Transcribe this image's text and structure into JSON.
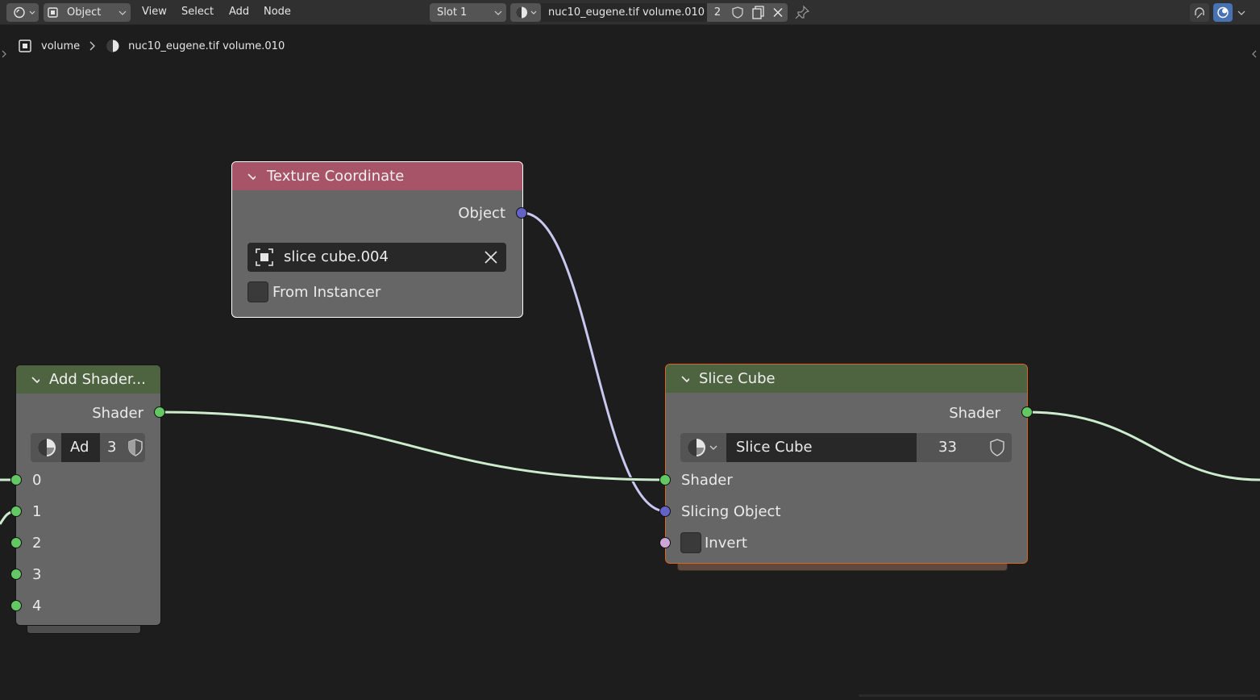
{
  "header": {
    "mode": "Object",
    "menus": [
      "View",
      "Select",
      "Add",
      "Node"
    ],
    "slot": "Slot 1",
    "material_name": "nuc10_eugene.tif volume.010",
    "user_count": "2"
  },
  "breadcrumb": {
    "object": "volume",
    "material": "nuc10_eugene.tif volume.010"
  },
  "nodes": {
    "texture_coordinate": {
      "title": "Texture Coordinate",
      "output": "Object",
      "object_field": "slice cube.004",
      "from_instancer": "From Instancer"
    },
    "add_shader": {
      "title": "Add Shader...",
      "output": "Shader",
      "group_name": "Ad",
      "group_users": "3",
      "inputs": [
        "0",
        "1",
        "2",
        "3",
        "4"
      ]
    },
    "slice_cube": {
      "title": "Slice Cube",
      "output": "Shader",
      "group_name": "Slice Cube",
      "group_users": "33",
      "inputs": [
        "Shader",
        "Slicing Object",
        "Invert"
      ]
    }
  },
  "colors": {
    "texture_header": "#a85468",
    "shader_header": "#4e633f",
    "shader_socket": "#63c763",
    "vector_socket": "#6363c7",
    "bool_socket": "#cca6d6",
    "selected_active": "#e0651b"
  }
}
